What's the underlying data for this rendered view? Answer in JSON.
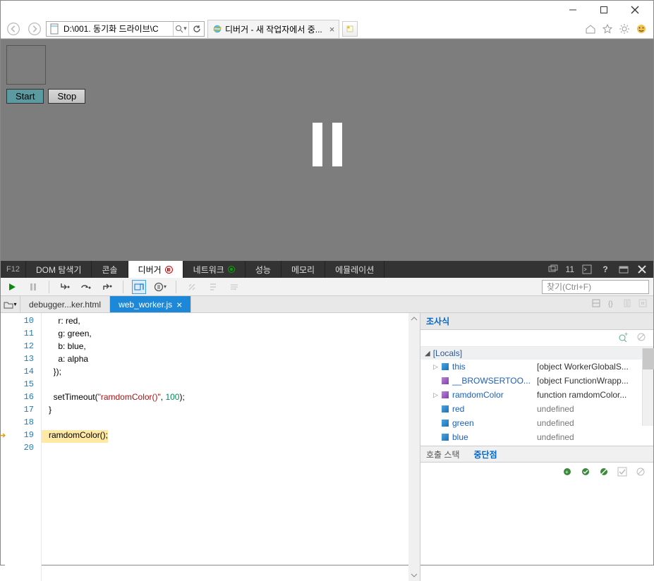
{
  "titlebar": {},
  "addressbar": {
    "url": "D:\\001. 동기화 드라이브\\C"
  },
  "tab": {
    "title": "디버거 - 새 작업자에서 중..."
  },
  "page": {
    "start_label": "Start",
    "stop_label": "Stop"
  },
  "devtools": {
    "f12": "F12",
    "tabs": {
      "dom": "DOM 탐색기",
      "console": "콘솔",
      "debugger": "디버거",
      "network": "네트워크",
      "performance": "성능",
      "memory": "메모리",
      "emulation": "에뮬레이션"
    },
    "error_count": "11"
  },
  "toolbar": {
    "search_placeholder": "찾기(Ctrl+F)"
  },
  "filetabs": {
    "file1": "debugger...ker.html",
    "file2": "web_worker.js"
  },
  "code": {
    "lines": [
      {
        "n": "10",
        "t": "    r: red,"
      },
      {
        "n": "11",
        "t": "    g: green,"
      },
      {
        "n": "12",
        "t": "    b: blue,"
      },
      {
        "n": "13",
        "t": "    a: alpha"
      },
      {
        "n": "14",
        "t": "  });"
      },
      {
        "n": "15",
        "t": ""
      },
      {
        "n": "16",
        "t": "  setTimeout(\"ramdomColor()\", 100);"
      },
      {
        "n": "17",
        "t": "}"
      },
      {
        "n": "18",
        "t": ""
      },
      {
        "n": "19",
        "t": "ramdomColor();",
        "hilite": true
      },
      {
        "n": "20",
        "t": ""
      }
    ]
  },
  "watches": {
    "title": "조사식",
    "locals_label": "[Locals]",
    "rows": [
      {
        "tri": "▷",
        "cube": "blue",
        "name": "this",
        "value": "[object WorkerGlobalS..."
      },
      {
        "tri": "",
        "cube": "purple",
        "name": "__BROWSERTOO...",
        "value": "[object FunctionWrapp..."
      },
      {
        "tri": "▷",
        "cube": "purple",
        "name": "ramdomColor",
        "value": "function ramdomColor..."
      },
      {
        "tri": "",
        "cube": "blue",
        "name": "red",
        "value": "undefined",
        "gray": true
      },
      {
        "tri": "",
        "cube": "blue",
        "name": "green",
        "value": "undefined",
        "gray": true
      },
      {
        "tri": "",
        "cube": "blue",
        "name": "blue",
        "value": "undefined",
        "gray": true
      }
    ]
  },
  "bottomtabs": {
    "callstack": "호출 스택",
    "breakpoints": "중단점"
  }
}
